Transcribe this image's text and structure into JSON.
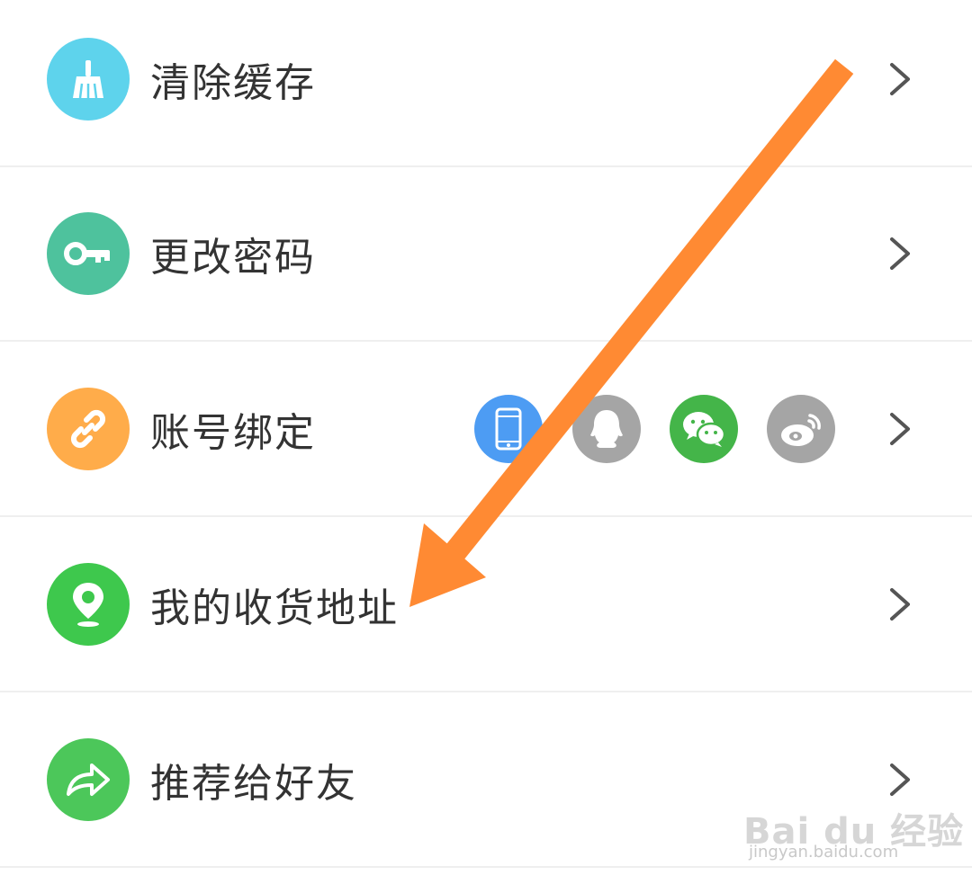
{
  "settings_list": {
    "items": [
      {
        "label": "清除缓存",
        "icon": "broom-icon",
        "color": "#5ed3ec"
      },
      {
        "label": "更改密码",
        "icon": "key-icon",
        "color": "#4ec29d"
      },
      {
        "label": "账号绑定",
        "icon": "link-icon",
        "color": "#ffac4a",
        "bindings": [
          {
            "icon": "phone-icon",
            "color": "#4d9cf3"
          },
          {
            "icon": "qq-icon",
            "color": "#a5a5a5"
          },
          {
            "icon": "wechat-icon",
            "color": "#44b549"
          },
          {
            "icon": "weibo-icon",
            "color": "#a5a5a5"
          }
        ]
      },
      {
        "label": "我的收货地址",
        "icon": "location-pin-icon",
        "color": "#3ec84d"
      },
      {
        "label": "推荐给好友",
        "icon": "share-icon",
        "color": "#4cc75a"
      }
    ]
  },
  "annotation": {
    "arrow_color": "#ff8a33"
  },
  "watermark": {
    "logo": "Bai du 经验",
    "url": "jingyan.baidu.com"
  }
}
